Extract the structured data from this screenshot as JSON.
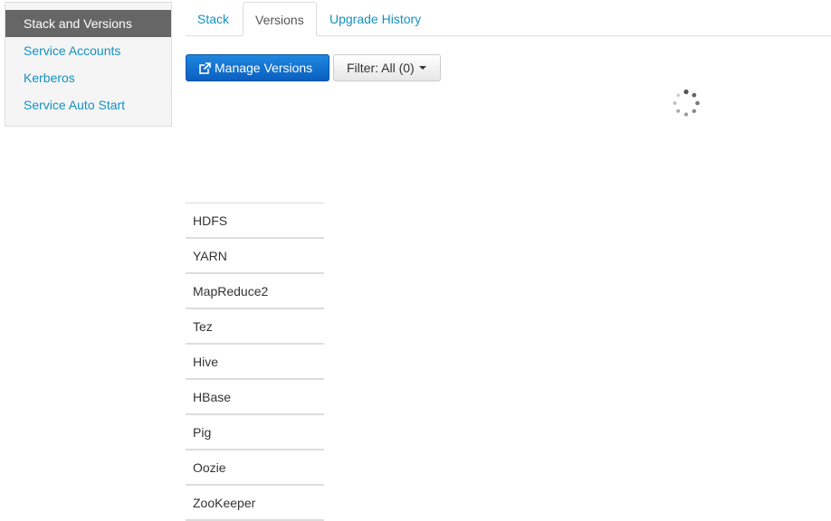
{
  "sidebar": {
    "items": [
      {
        "label": "Stack and Versions",
        "active": true
      },
      {
        "label": "Service Accounts",
        "active": false
      },
      {
        "label": "Kerberos",
        "active": false
      },
      {
        "label": "Service Auto Start",
        "active": false
      }
    ]
  },
  "tabs": [
    {
      "label": "Stack",
      "active": false
    },
    {
      "label": "Versions",
      "active": true
    },
    {
      "label": "Upgrade History",
      "active": false
    }
  ],
  "toolbar": {
    "manage_versions_label": "Manage Versions",
    "manage_versions_icon": "external-link-icon",
    "filter_label": "Filter: All (0)",
    "filter_icon": "caret-down-icon"
  },
  "loading": {
    "icon": "spinner-icon"
  },
  "services": [
    "HDFS",
    "YARN",
    "MapReduce2",
    "Tez",
    "Hive",
    "HBase",
    "Pig",
    "Oozie",
    "ZooKeeper"
  ],
  "colors": {
    "link": "#1491c1",
    "active_sidebar_bg": "#666666",
    "primary_button": "#0a6ecc",
    "border": "#dddddd"
  }
}
